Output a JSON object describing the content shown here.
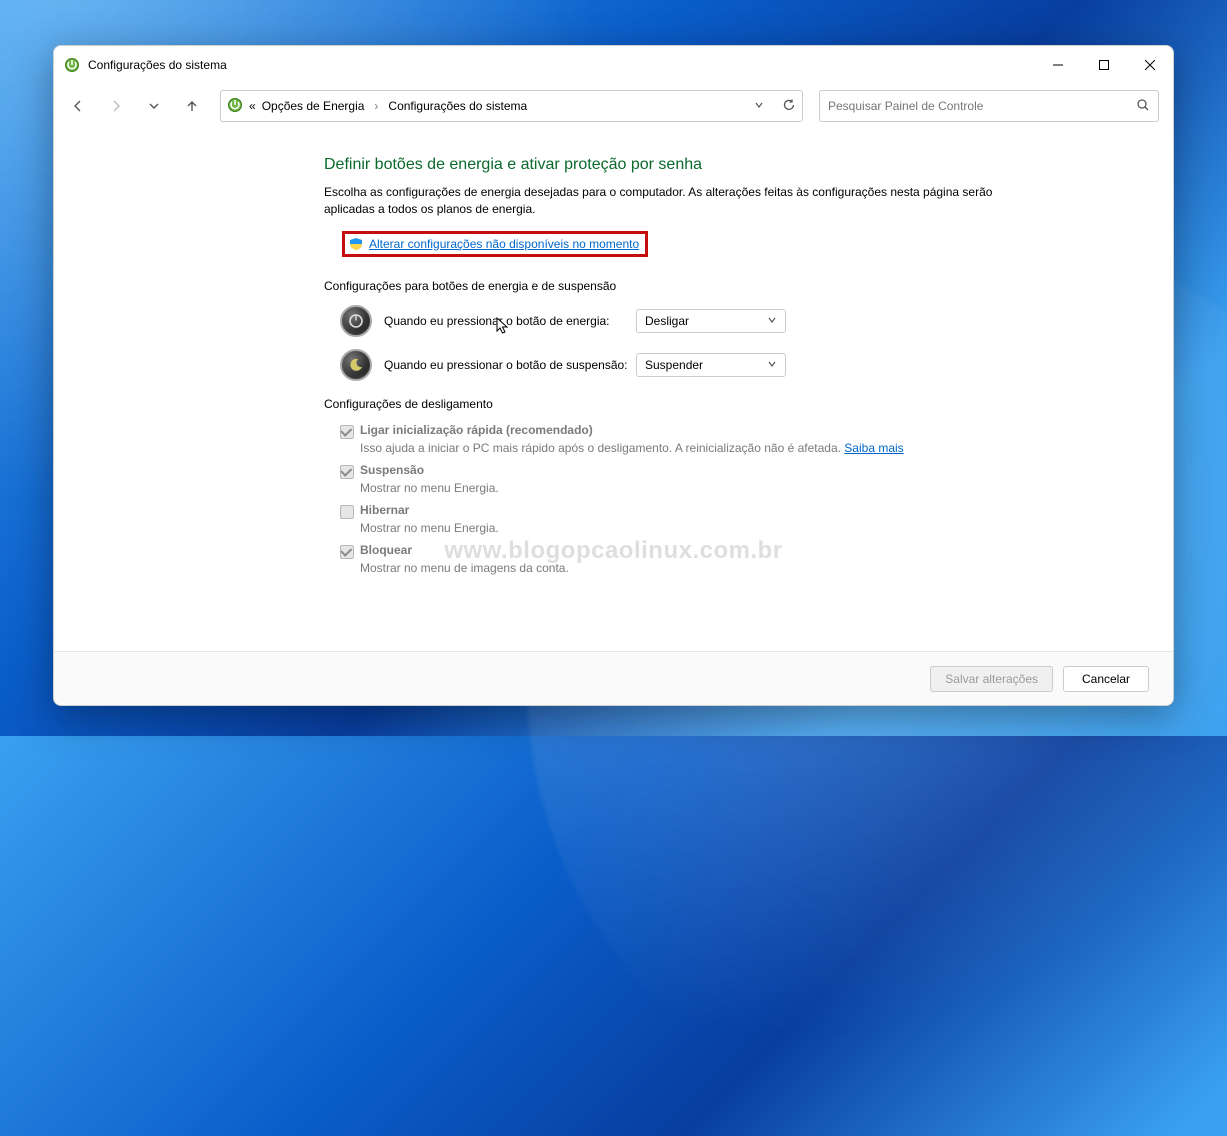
{
  "window": {
    "title": "Configurações do sistema"
  },
  "breadcrumb": {
    "item1": "Opções de Energia",
    "item2": "Configurações do sistema"
  },
  "search": {
    "placeholder": "Pesquisar Painel de Controle"
  },
  "main": {
    "heading": "Definir botões de energia e ativar proteção por senha",
    "description": "Escolha as configurações de energia desejadas para o computador. As alterações feitas às configurações nesta página serão aplicadas a todos os planos de energia.",
    "uac_link": "Alterar configurações não disponíveis no momento",
    "buttons_section_label": "Configurações para botões de energia e de suspensão",
    "power_button": {
      "label": "Quando eu pressionar o botão de energia:",
      "value": "Desligar"
    },
    "sleep_button": {
      "label": "Quando eu pressionar o botão de suspensão:",
      "value": "Suspender"
    },
    "shutdown_section_label": "Configurações de desligamento",
    "fast_startup": {
      "label": "Ligar inicialização rápida (recomendado)",
      "desc": "Isso ajuda a iniciar o PC mais rápido após o desligamento. A reinicialização não é afetada. ",
      "learn_more": "Saiba mais"
    },
    "suspend_opt": {
      "label": "Suspensão",
      "desc": "Mostrar no menu Energia."
    },
    "hibernate_opt": {
      "label": "Hibernar",
      "desc": "Mostrar no menu Energia."
    },
    "lock_opt": {
      "label": "Bloquear",
      "desc": "Mostrar no menu de imagens da conta."
    }
  },
  "footer": {
    "save": "Salvar alterações",
    "cancel": "Cancelar"
  },
  "watermark": "www.blogopcaolinux.com.br"
}
